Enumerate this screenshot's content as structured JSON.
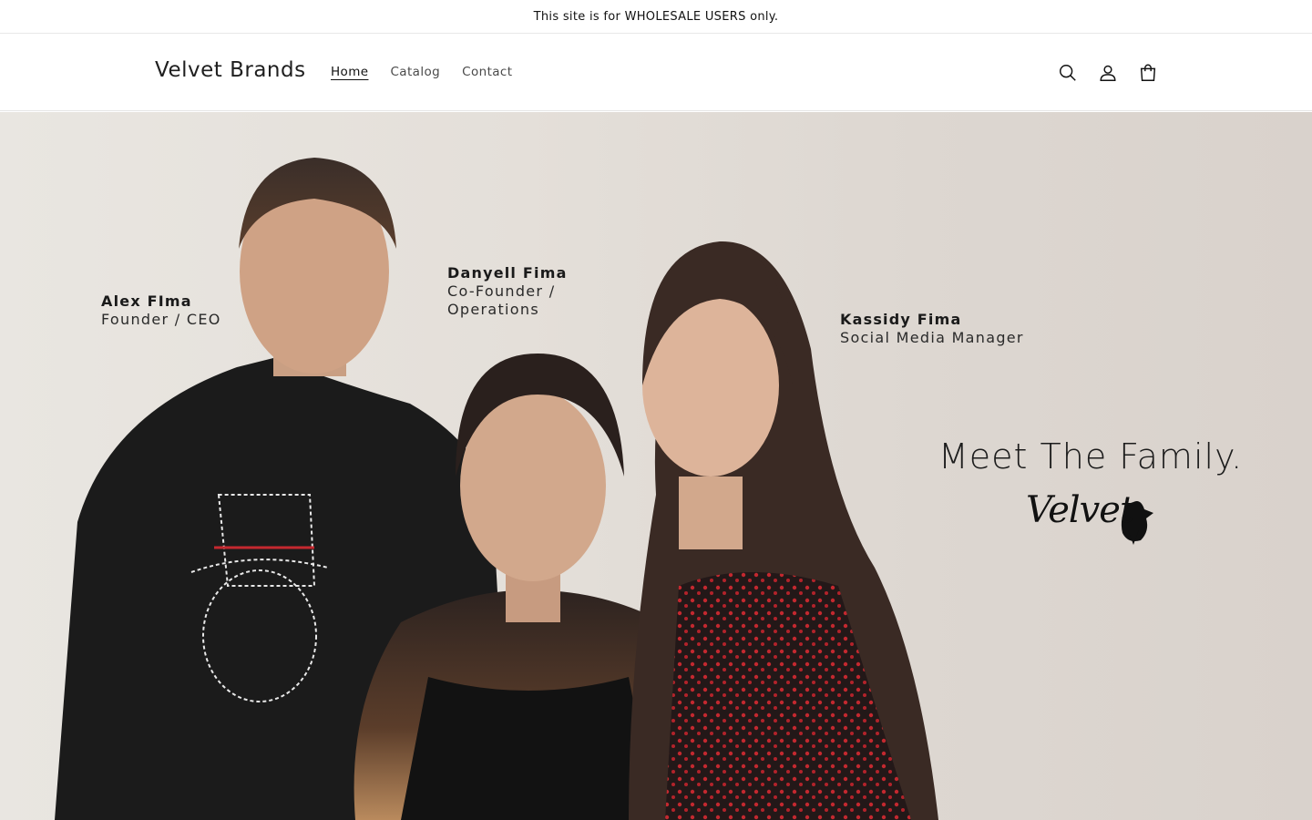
{
  "announcement": {
    "text": "This site is for WHOLESALE USERS only."
  },
  "header": {
    "logo": "Velvet Brands",
    "nav": [
      {
        "label": "Home",
        "active": true
      },
      {
        "label": "Catalog",
        "active": false
      },
      {
        "label": "Contact",
        "active": false
      }
    ],
    "icons": [
      "search-icon",
      "account-icon",
      "cart-icon"
    ]
  },
  "hero": {
    "people": [
      {
        "name": "Alex FIma",
        "role": "Founder / CEO"
      },
      {
        "name": "Danyell Fima",
        "role_line1": "Co-Founder /",
        "role_line2": "Operations"
      },
      {
        "name": "Kassidy Fima",
        "role": "Social Media Manager"
      }
    ],
    "headline": "Meet The Family.",
    "brand_mark": "Velvet"
  },
  "colors": {
    "text": "#121212",
    "hero_bg": "#e4dfd9",
    "shirt": "#1b1b1b",
    "dress": "#b5222a"
  }
}
